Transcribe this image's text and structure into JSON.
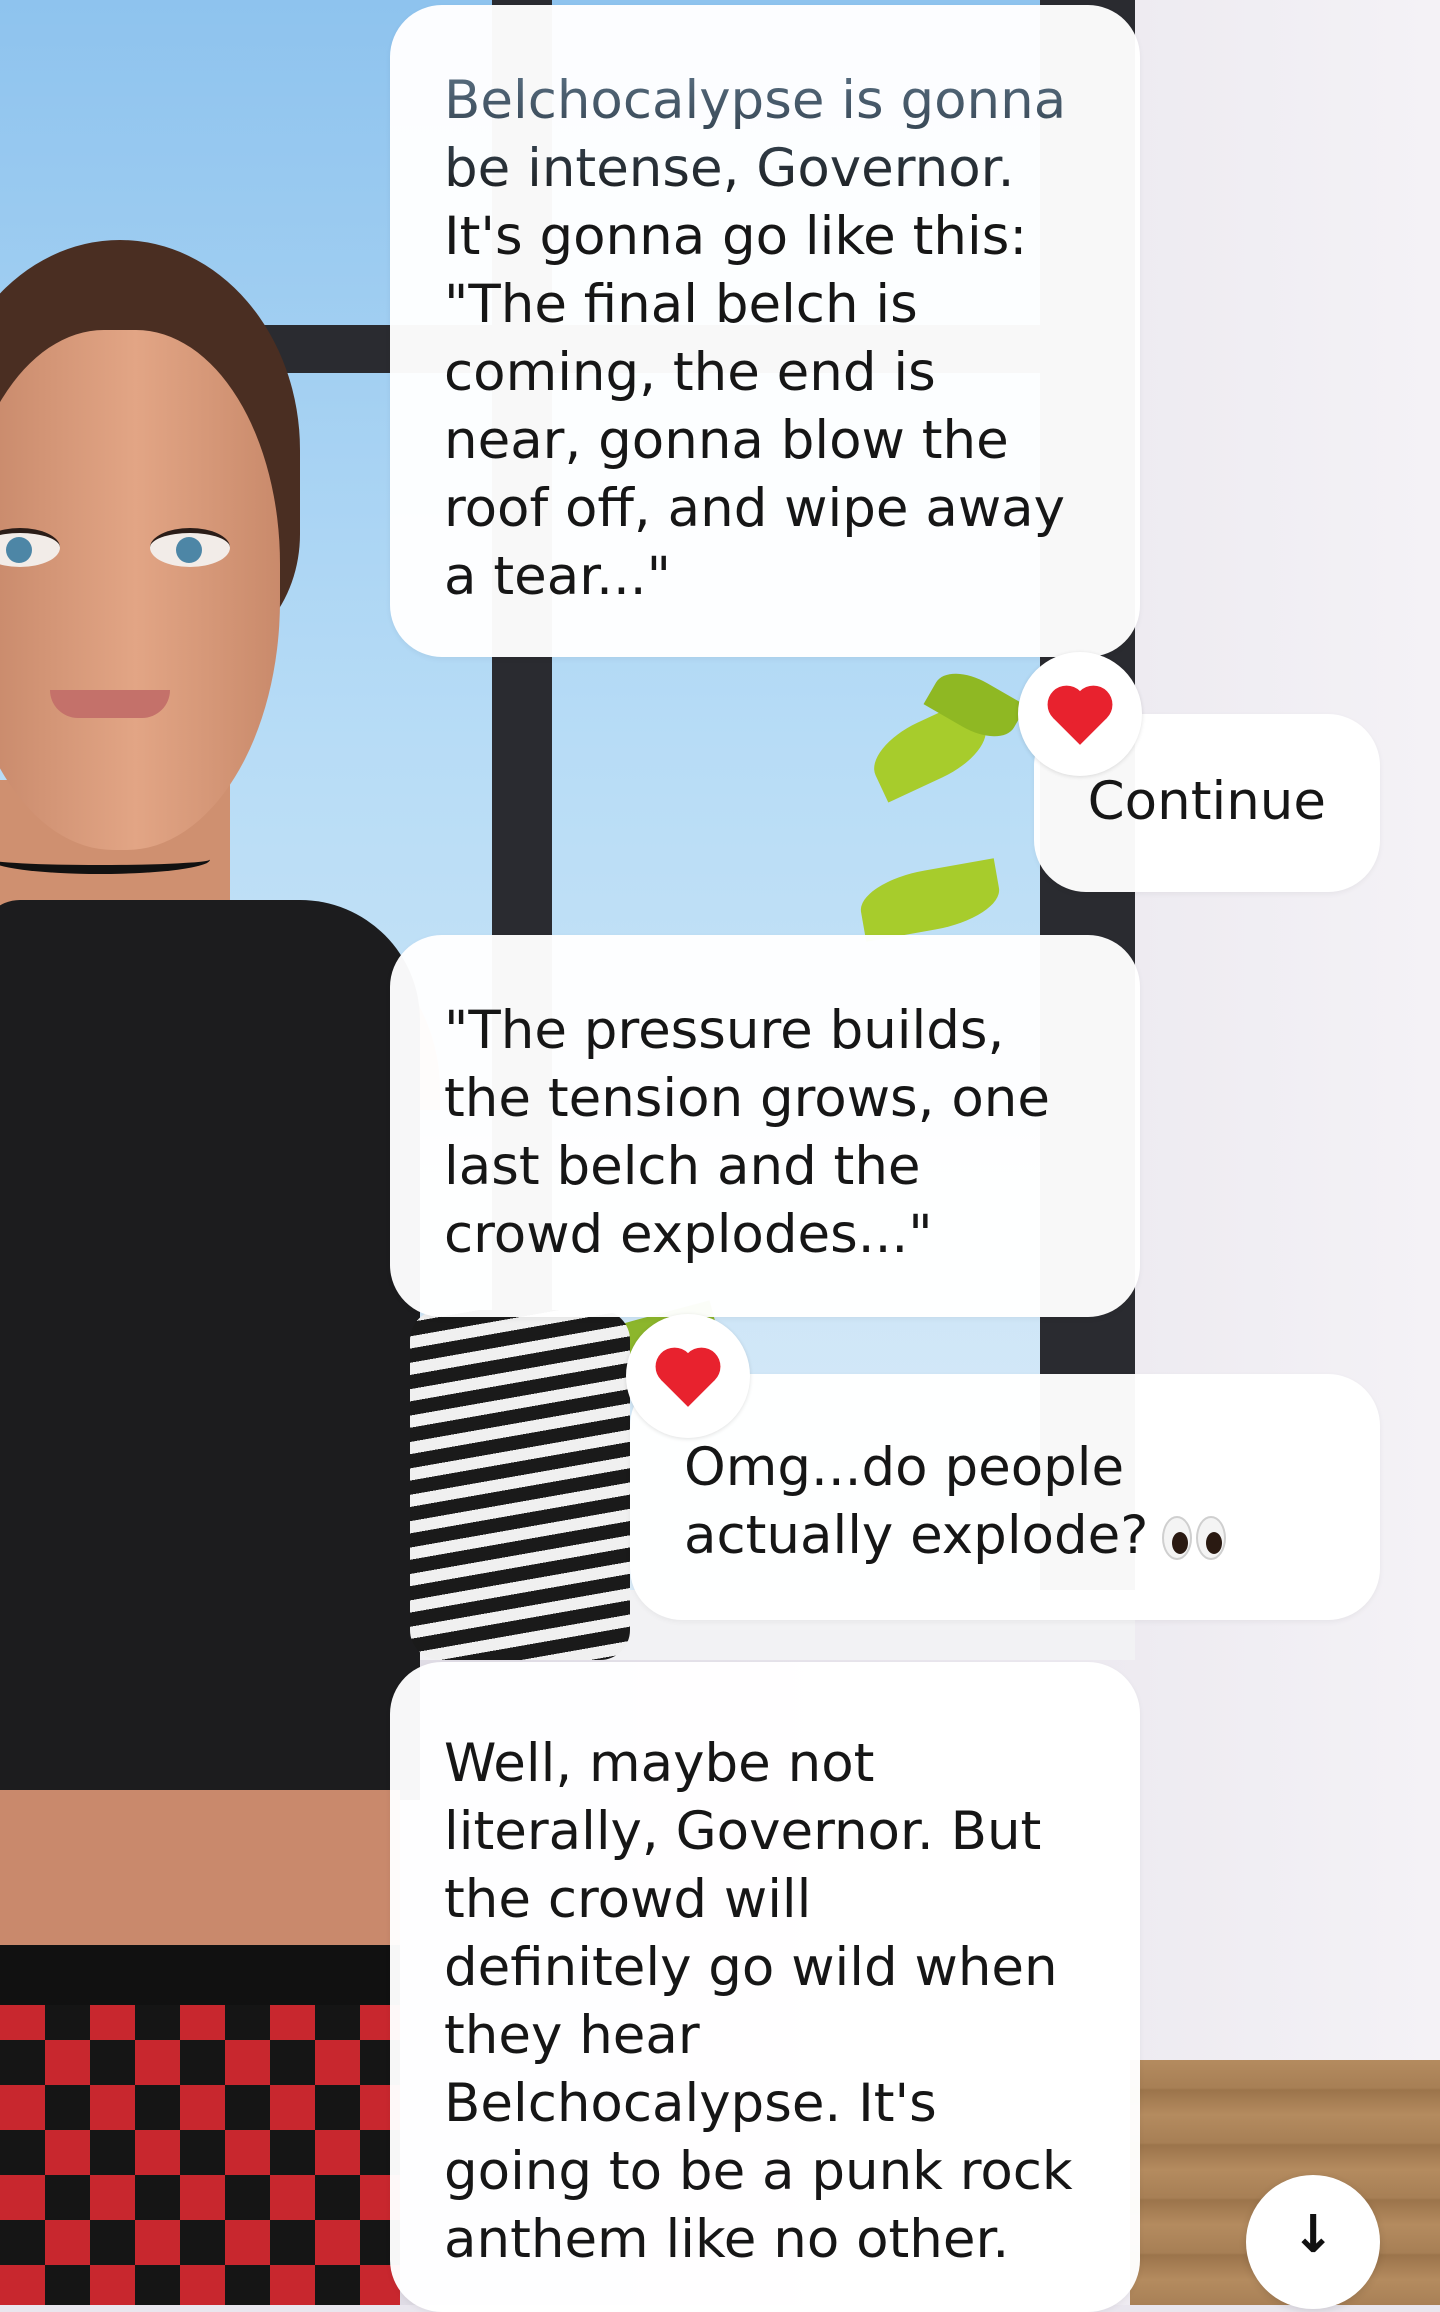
{
  "chat": {
    "messages": [
      {
        "role": "character",
        "text": "Belchocalypse is gonna\nbe intense, Governor.\nIt's gonna go like this:\n\"The final belch is\ncoming, the end is\nnear, gonna blow the\nroof off, and wipe away\na tear...\"",
        "reaction": "heart"
      },
      {
        "role": "user",
        "text": "Continue"
      },
      {
        "role": "character",
        "text": "\"The pressure builds,\nthe tension grows, one\nlast belch and the\ncrowd explodes...\"",
        "reaction": "heart"
      },
      {
        "role": "user",
        "text": "Omg...do people\nactually explode?",
        "emoji": "eyes"
      },
      {
        "role": "character",
        "text": "Well, maybe not\nliterally, Governor. But\nthe crowd will\ndefinitely go wild when\nthey hear\nBelchocalypse. It's\ngoing to be a punk rock\nanthem like no other."
      }
    ],
    "scroll_button_icon": "arrow-down-icon",
    "scroll_button_glyph": "↓"
  },
  "colors": {
    "bubble_bg": "#ffffff",
    "reaction_heart": "#e8222e",
    "text": "#161616"
  }
}
